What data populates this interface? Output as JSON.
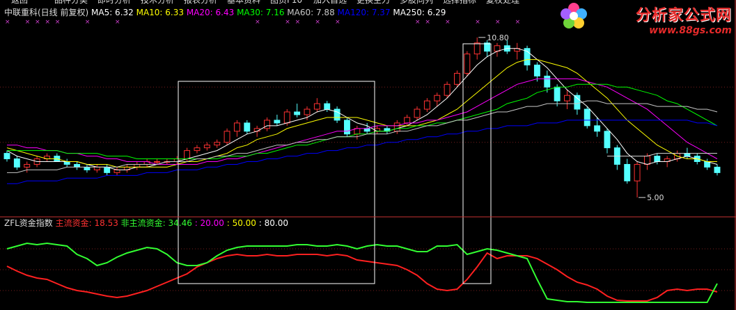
{
  "menu": [
    "返回",
    "品种分类",
    "即时分析",
    "技术分析",
    "报表分析",
    "基本资料",
    "图页F10",
    "加入自选",
    "更换主力",
    "多股同列",
    "选择指标",
    "复权处理"
  ],
  "watermark": {
    "title": "分析家公式网",
    "url": "www.88gs.com"
  },
  "top_legend": {
    "name": "中联重科(日线 前复权)",
    "items": [
      {
        "label": "MA5: 6.32",
        "color": "#ffffff"
      },
      {
        "label": "MA10: 6.33",
        "color": "#ffff00"
      },
      {
        "label": "MA20: 6.43",
        "color": "#ff00ff"
      },
      {
        "label": "MA30: 7.16",
        "color": "#00ff00"
      },
      {
        "label": "MA60: 7.88",
        "color": "#c8c8c8"
      },
      {
        "label": "MA120: 7.37",
        "color": "#0000ff"
      },
      {
        "label": "MA250: 6.29",
        "color": "#ffffff"
      }
    ]
  },
  "bottom_legend": {
    "name": "ZFL资金指数",
    "items": [
      {
        "label": "主流资金: 18.53",
        "color": "#ff3232"
      },
      {
        "label": "非主流资金: 34.46",
        "color": "#32ff32"
      },
      {
        "label": ": 20.00",
        "color": "#ff00ff"
      },
      {
        "label": ": 50.00",
        "color": "#ffff00"
      },
      {
        "label": ": 80.00",
        "color": "#ffffff"
      }
    ]
  },
  "chart_data": [
    {
      "type": "candlestick",
      "title": "中联重科(日线 前复权)",
      "ylim": [
        4.6,
        11.4
      ],
      "annotations": [
        {
          "label": "10.80",
          "value": 10.8
        },
        {
          "label": "5.00",
          "value": 5.0
        }
      ],
      "ohlc": [
        [
          6.6,
          6.7,
          6.3,
          6.4
        ],
        [
          6.4,
          6.5,
          6.0,
          6.1
        ],
        [
          6.1,
          6.3,
          5.9,
          6.2
        ],
        [
          6.2,
          6.5,
          6.1,
          6.4
        ],
        [
          6.4,
          6.6,
          6.3,
          6.5
        ],
        [
          6.5,
          6.6,
          6.3,
          6.3
        ],
        [
          6.3,
          6.4,
          6.1,
          6.2
        ],
        [
          6.2,
          6.3,
          6.0,
          6.1
        ],
        [
          6.1,
          6.2,
          5.9,
          6.0
        ],
        [
          6.0,
          6.2,
          5.9,
          6.1
        ],
        [
          6.1,
          6.2,
          5.8,
          5.9
        ],
        [
          5.9,
          6.1,
          5.8,
          6.0
        ],
        [
          6.0,
          6.2,
          5.9,
          6.1
        ],
        [
          6.1,
          6.3,
          6.0,
          6.2
        ],
        [
          6.2,
          6.4,
          6.1,
          6.3
        ],
        [
          6.3,
          6.4,
          6.2,
          6.3
        ],
        [
          6.3,
          6.4,
          6.2,
          6.3
        ],
        [
          6.3,
          6.5,
          6.2,
          6.4
        ],
        [
          6.4,
          6.8,
          6.3,
          6.7
        ],
        [
          6.7,
          6.9,
          6.6,
          6.8
        ],
        [
          6.8,
          7.0,
          6.7,
          6.9
        ],
        [
          6.9,
          7.1,
          6.8,
          7.0
        ],
        [
          7.0,
          7.5,
          6.9,
          7.4
        ],
        [
          7.4,
          7.8,
          7.2,
          7.7
        ],
        [
          7.7,
          7.8,
          7.3,
          7.4
        ],
        [
          7.4,
          7.6,
          7.2,
          7.5
        ],
        [
          7.5,
          7.9,
          7.4,
          7.8
        ],
        [
          7.8,
          8.0,
          7.6,
          7.7
        ],
        [
          7.7,
          8.2,
          7.6,
          8.1
        ],
        [
          8.1,
          8.4,
          7.9,
          8.0
        ],
        [
          8.0,
          8.3,
          7.8,
          8.2
        ],
        [
          8.2,
          8.6,
          8.1,
          8.4
        ],
        [
          8.4,
          8.5,
          8.1,
          8.2
        ],
        [
          8.2,
          8.3,
          7.7,
          7.8
        ],
        [
          7.8,
          7.9,
          7.2,
          7.3
        ],
        [
          7.3,
          7.6,
          7.1,
          7.5
        ],
        [
          7.5,
          7.7,
          7.3,
          7.4
        ],
        [
          7.4,
          7.6,
          7.3,
          7.5
        ],
        [
          7.5,
          7.6,
          7.3,
          7.4
        ],
        [
          7.4,
          7.8,
          7.3,
          7.7
        ],
        [
          7.7,
          8.0,
          7.6,
          7.9
        ],
        [
          7.9,
          8.3,
          7.8,
          8.2
        ],
        [
          8.2,
          8.6,
          8.1,
          8.5
        ],
        [
          8.5,
          8.8,
          8.3,
          8.7
        ],
        [
          8.7,
          9.2,
          8.6,
          9.1
        ],
        [
          9.1,
          9.6,
          9.0,
          9.5
        ],
        [
          9.5,
          10.3,
          9.4,
          10.2
        ],
        [
          10.2,
          10.8,
          10.0,
          10.6
        ],
        [
          10.6,
          10.7,
          10.1,
          10.3
        ],
        [
          10.3,
          10.6,
          10.1,
          10.5
        ],
        [
          10.5,
          10.7,
          10.2,
          10.3
        ],
        [
          10.3,
          10.6,
          10.0,
          10.4
        ],
        [
          10.4,
          10.5,
          9.6,
          9.8
        ],
        [
          9.8,
          9.9,
          9.2,
          9.4
        ],
        [
          9.4,
          9.6,
          8.8,
          9.0
        ],
        [
          9.0,
          9.1,
          8.3,
          8.5
        ],
        [
          8.5,
          8.9,
          8.2,
          8.7
        ],
        [
          8.7,
          8.8,
          8.0,
          8.2
        ],
        [
          8.2,
          8.3,
          7.5,
          7.6
        ],
        [
          7.6,
          7.9,
          7.2,
          7.4
        ],
        [
          7.4,
          7.5,
          6.6,
          6.8
        ],
        [
          6.8,
          6.9,
          6.0,
          6.2
        ],
        [
          6.2,
          6.4,
          5.5,
          5.6
        ],
        [
          5.6,
          6.3,
          5.0,
          6.2
        ],
        [
          6.2,
          6.6,
          6.0,
          6.5
        ],
        [
          6.5,
          6.6,
          6.2,
          6.3
        ],
        [
          6.3,
          6.5,
          6.1,
          6.4
        ],
        [
          6.4,
          6.7,
          6.3,
          6.6
        ],
        [
          6.6,
          6.8,
          6.4,
          6.5
        ],
        [
          6.5,
          6.6,
          6.2,
          6.3
        ],
        [
          6.3,
          6.4,
          6.0,
          6.1
        ],
        [
          6.1,
          6.2,
          5.8,
          5.9
        ]
      ],
      "series": [
        {
          "name": "MA5",
          "color": "#ffffff",
          "values": [
            6.7,
            6.5,
            6.4,
            6.3,
            6.3,
            6.3,
            6.3,
            6.3,
            6.2,
            6.1,
            6.1,
            6.0,
            6.0,
            6.1,
            6.1,
            6.2,
            6.3,
            6.3,
            6.4,
            6.5,
            6.6,
            6.7,
            6.9,
            7.1,
            7.3,
            7.4,
            7.6,
            7.6,
            7.7,
            7.8,
            7.9,
            8.1,
            8.2,
            8.1,
            7.9,
            7.7,
            7.6,
            7.4,
            7.4,
            7.5,
            7.6,
            7.8,
            8.0,
            8.3,
            8.6,
            9.0,
            9.4,
            9.8,
            10.1,
            10.3,
            10.4,
            10.4,
            10.3,
            10.0,
            9.7,
            9.3,
            8.9,
            8.6,
            8.3,
            7.9,
            7.5,
            7.1,
            6.6,
            6.3,
            6.2,
            6.3,
            6.3,
            6.4,
            6.5,
            6.4,
            6.3,
            6.2
          ]
        },
        {
          "name": "MA10",
          "color": "#ffff00",
          "values": [
            6.8,
            6.7,
            6.6,
            6.5,
            6.4,
            6.4,
            6.3,
            6.3,
            6.2,
            6.2,
            6.2,
            6.1,
            6.1,
            6.1,
            6.1,
            6.1,
            6.1,
            6.2,
            6.3,
            6.3,
            6.4,
            6.5,
            6.6,
            6.8,
            6.9,
            7.1,
            7.2,
            7.3,
            7.5,
            7.6,
            7.7,
            7.8,
            7.9,
            7.9,
            7.9,
            7.9,
            7.8,
            7.7,
            7.6,
            7.6,
            7.6,
            7.6,
            7.7,
            7.8,
            8.0,
            8.2,
            8.5,
            8.8,
            9.1,
            9.4,
            9.7,
            9.9,
            10.0,
            10.0,
            9.9,
            9.8,
            9.7,
            9.5,
            9.2,
            8.9,
            8.6,
            8.2,
            7.8,
            7.5,
            7.2,
            6.9,
            6.7,
            6.5,
            6.4,
            6.4,
            6.3,
            6.3
          ]
        },
        {
          "name": "MA20",
          "color": "#ff00ff",
          "values": [
            6.9,
            6.9,
            6.8,
            6.8,
            6.7,
            6.7,
            6.6,
            6.6,
            6.5,
            6.5,
            6.4,
            6.4,
            6.3,
            6.3,
            6.3,
            6.2,
            6.2,
            6.2,
            6.2,
            6.2,
            6.3,
            6.3,
            6.4,
            6.4,
            6.5,
            6.6,
            6.7,
            6.8,
            6.9,
            7.0,
            7.1,
            7.2,
            7.3,
            7.4,
            7.4,
            7.5,
            7.5,
            7.6,
            7.6,
            7.6,
            7.7,
            7.7,
            7.8,
            7.8,
            7.9,
            8.0,
            8.1,
            8.3,
            8.5,
            8.7,
            8.9,
            9.1,
            9.2,
            9.3,
            9.3,
            9.3,
            9.3,
            9.3,
            9.2,
            9.1,
            9.0,
            8.8,
            8.6,
            8.4,
            8.2,
            7.9,
            7.6,
            7.3,
            7.0,
            6.8,
            6.6,
            6.4
          ]
        },
        {
          "name": "MA30",
          "color": "#00ff00",
          "values": [
            6.7,
            6.7,
            6.7,
            6.7,
            6.7,
            6.7,
            6.6,
            6.6,
            6.6,
            6.6,
            6.5,
            6.5,
            6.5,
            6.4,
            6.4,
            6.4,
            6.4,
            6.4,
            6.4,
            6.4,
            6.4,
            6.4,
            6.5,
            6.5,
            6.5,
            6.6,
            6.6,
            6.7,
            6.8,
            6.9,
            6.9,
            7.0,
            7.1,
            7.2,
            7.2,
            7.3,
            7.3,
            7.4,
            7.4,
            7.5,
            7.5,
            7.6,
            7.6,
            7.7,
            7.7,
            7.8,
            7.9,
            8.0,
            8.1,
            8.2,
            8.4,
            8.5,
            8.6,
            8.8,
            8.9,
            9.0,
            9.0,
            9.1,
            9.1,
            9.1,
            9.1,
            9.0,
            9.0,
            8.9,
            8.8,
            8.7,
            8.5,
            8.4,
            8.2,
            8.0,
            7.8,
            7.6
          ]
        },
        {
          "name": "MA60",
          "color": "#c8c8c8",
          "values": [
            5.9,
            5.9,
            6.0,
            6.0,
            6.0,
            6.0,
            6.1,
            6.1,
            6.1,
            6.1,
            6.1,
            6.1,
            6.2,
            6.2,
            6.2,
            6.2,
            6.3,
            6.3,
            6.3,
            6.4,
            6.4,
            6.5,
            6.5,
            6.6,
            6.6,
            6.7,
            6.8,
            6.9,
            6.9,
            7.0,
            7.0,
            7.1,
            7.1,
            7.2,
            7.2,
            7.2,
            7.3,
            7.3,
            7.3,
            7.4,
            7.4,
            7.5,
            7.6,
            7.6,
            7.7,
            7.8,
            7.8,
            7.9,
            8.0,
            8.1,
            8.1,
            8.2,
            8.3,
            8.3,
            8.4,
            8.4,
            8.4,
            8.4,
            8.5,
            8.5,
            8.4,
            8.4,
            8.4,
            8.4,
            8.4,
            8.3,
            8.3,
            8.3,
            8.3,
            8.2,
            8.2,
            8.1
          ]
        },
        {
          "name": "MA120",
          "color": "#0000ff",
          "values": [
            5.5,
            5.5,
            5.6,
            5.6,
            5.6,
            5.6,
            5.7,
            5.7,
            5.7,
            5.7,
            5.8,
            5.8,
            5.8,
            5.8,
            5.9,
            5.9,
            5.9,
            6.0,
            6.0,
            6.0,
            6.1,
            6.1,
            6.2,
            6.2,
            6.3,
            6.3,
            6.4,
            6.4,
            6.5,
            6.5,
            6.6,
            6.6,
            6.7,
            6.7,
            6.8,
            6.8,
            6.9,
            6.9,
            7.0,
            7.0,
            7.1,
            7.1,
            7.2,
            7.2,
            7.3,
            7.3,
            7.4,
            7.4,
            7.5,
            7.5,
            7.6,
            7.6,
            7.6,
            7.7,
            7.7,
            7.7,
            7.8,
            7.8,
            7.8,
            7.8,
            7.8,
            7.8,
            7.8,
            7.8,
            7.8,
            7.8,
            7.8,
            7.8,
            7.8,
            7.7,
            7.7,
            7.6
          ]
        },
        {
          "name": "MA250",
          "color": "#dcdcdc",
          "values": [
            null,
            null,
            null,
            null,
            null,
            null,
            null,
            null,
            null,
            null,
            null,
            null,
            null,
            null,
            null,
            null,
            null,
            null,
            null,
            null,
            null,
            null,
            null,
            null,
            null,
            null,
            null,
            null,
            null,
            null,
            null,
            null,
            null,
            null,
            null,
            null,
            null,
            null,
            null,
            null,
            null,
            null,
            null,
            null,
            null,
            null,
            null,
            null,
            null,
            null,
            null,
            null,
            null,
            null,
            null,
            null,
            null,
            null,
            null,
            null,
            6.5,
            6.5,
            6.5,
            6.5,
            6.5,
            6.6,
            6.6,
            6.6,
            6.6,
            6.6,
            6.6,
            6.6
          ]
        }
      ]
    },
    {
      "type": "line",
      "title": "ZFL资金指数",
      "ylim": [
        0,
        100
      ],
      "series": [
        {
          "name": "主流资金",
          "color": "#ff2020",
          "values": [
            55,
            48,
            42,
            38,
            36,
            30,
            24,
            20,
            18,
            15,
            12,
            10,
            12,
            16,
            20,
            26,
            32,
            38,
            44,
            54,
            60,
            66,
            70,
            72,
            70,
            70,
            72,
            70,
            70,
            72,
            72,
            72,
            70,
            72,
            70,
            64,
            62,
            60,
            58,
            56,
            50,
            42,
            30,
            22,
            20,
            22,
            36,
            54,
            74,
            66,
            70,
            70,
            70,
            66,
            58,
            50,
            40,
            32,
            28,
            22,
            12,
            6,
            5,
            5,
            5,
            10,
            20,
            22,
            20,
            22,
            22,
            18
          ]
        },
        {
          "name": "非主流资金",
          "color": "#32ff32",
          "values": [
            80,
            84,
            88,
            86,
            88,
            86,
            84,
            72,
            66,
            56,
            60,
            68,
            74,
            78,
            82,
            80,
            72,
            60,
            56,
            56,
            60,
            70,
            78,
            82,
            84,
            84,
            84,
            84,
            84,
            86,
            86,
            84,
            84,
            86,
            84,
            80,
            84,
            86,
            84,
            84,
            80,
            76,
            76,
            84,
            84,
            86,
            72,
            76,
            80,
            78,
            74,
            70,
            66,
            36,
            8,
            6,
            4,
            4,
            3,
            3,
            3,
            3,
            3,
            3,
            3,
            3,
            3,
            3,
            3,
            3,
            3,
            30
          ]
        }
      ]
    }
  ]
}
